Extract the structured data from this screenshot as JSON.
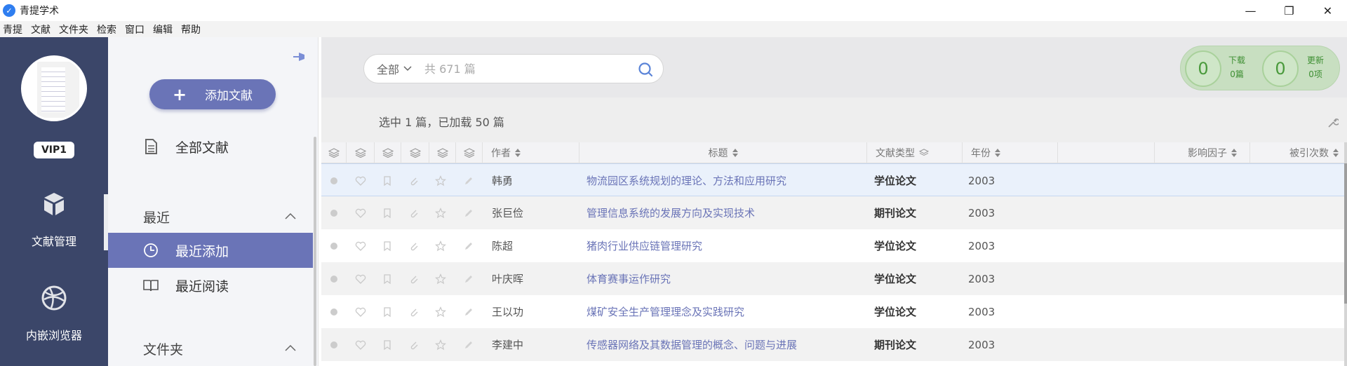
{
  "app": {
    "title": "青提学术"
  },
  "window": {
    "minimize": "—",
    "maximize": "❐",
    "close": "✕"
  },
  "menu": [
    "青提",
    "文献",
    "文件夹",
    "检索",
    "窗口",
    "编辑",
    "帮助"
  ],
  "rail": {
    "vip": "VIP1",
    "items": [
      {
        "label": "文献管理",
        "icon": "cube-icon"
      },
      {
        "label": "内嵌浏览器",
        "icon": "browser-globe-icon"
      }
    ]
  },
  "sidebar": {
    "add_button": "添加文献",
    "all_docs": "全部文献",
    "recent_title": "最近",
    "recent_items": [
      "最近添加",
      "最近阅读"
    ],
    "folder_title": "文件夹"
  },
  "search": {
    "scope": "全部",
    "placeholder": "共 671 篇"
  },
  "stats": {
    "download": {
      "value": "0",
      "label": "下载",
      "sub": "0篇"
    },
    "update": {
      "value": "0",
      "label": "更新",
      "sub": "0项"
    },
    "accent": "#4a9a3c"
  },
  "toolbar": {
    "selection": "选中 1 篇，已加载 50 篇"
  },
  "table": {
    "headers": {
      "author": "作者",
      "title": "标题",
      "type": "文献类型",
      "year": "年份",
      "impact": "影响因子",
      "cites": "被引次数"
    },
    "rows": [
      {
        "author": "韩勇",
        "title": "物流园区系统规划的理论、方法和应用研究",
        "type": "学位论文",
        "year": "2003"
      },
      {
        "author": "张巨俭",
        "title": "管理信息系统的发展方向及实现技术",
        "type": "期刊论文",
        "year": "2003"
      },
      {
        "author": "陈超",
        "title": "猪肉行业供应链管理研究",
        "type": "学位论文",
        "year": "2003"
      },
      {
        "author": "叶庆晖",
        "title": "体育赛事运作研究",
        "type": "学位论文",
        "year": "2003"
      },
      {
        "author": "王以功",
        "title": "煤矿安全生产管理理念及实践研究",
        "type": "学位论文",
        "year": "2003"
      },
      {
        "author": "李建中",
        "title": "传感器网络及其数据管理的概念、问题与进展",
        "type": "期刊论文",
        "year": "2003"
      }
    ]
  },
  "colors": {
    "rail": "#3b4669",
    "accent": "#6a74b7",
    "title_link": "#6a74b7"
  }
}
